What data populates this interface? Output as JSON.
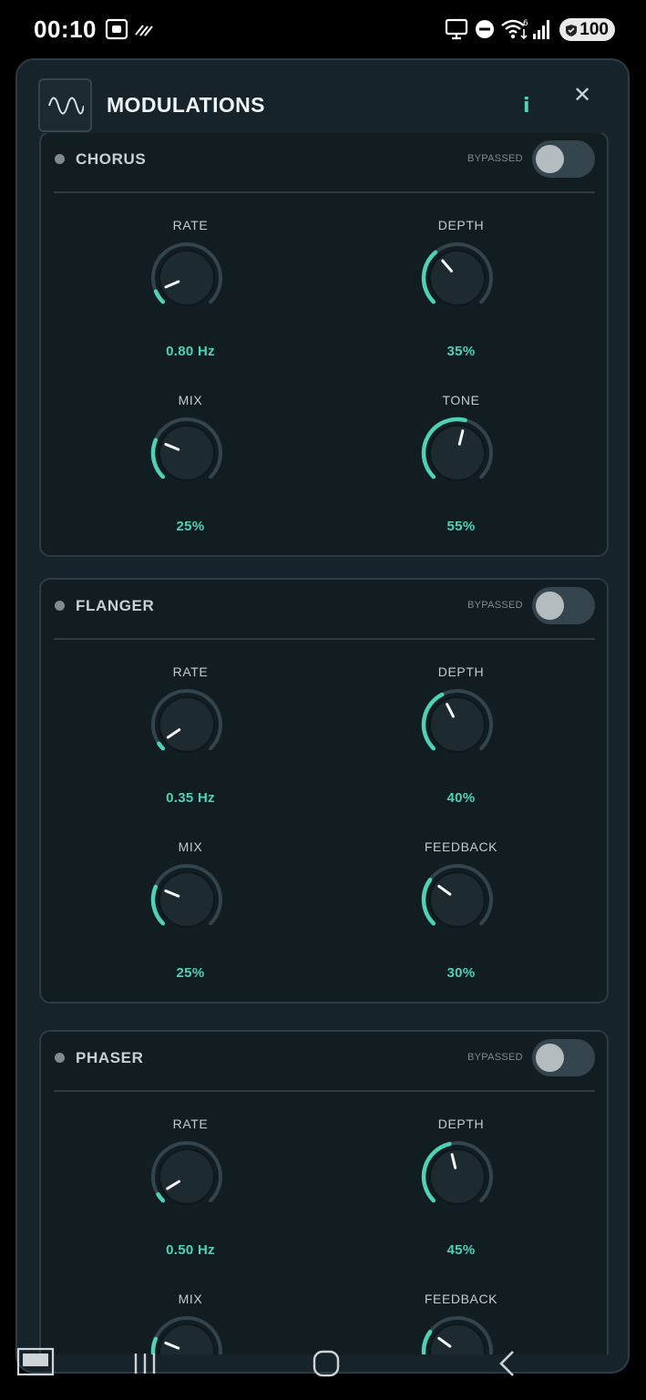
{
  "status_bar": {
    "time": "00:10",
    "battery": "100",
    "icons": [
      "screenshot-icon",
      "nfc-icon",
      "monitor-icon",
      "dnd-icon",
      "wifi-icon",
      "signal-icon",
      "battery-icon"
    ]
  },
  "modal": {
    "title": "MODULATIONS",
    "info_label": "i",
    "close_label": "✕",
    "logo_icon": "wave-icon"
  },
  "colors": {
    "accent": "#4fd1b5",
    "panel": "#16232a",
    "section": "#121d22",
    "track": "#33444c"
  },
  "sections": [
    {
      "name": "CHORUS",
      "status": "BYPASSED",
      "enabled": false,
      "knobs": [
        {
          "label": "RATE",
          "value": "0.80 Hz",
          "level": 0.08
        },
        {
          "label": "DEPTH",
          "value": "35%",
          "level": 0.35
        },
        {
          "label": "MIX",
          "value": "25%",
          "level": 0.25
        },
        {
          "label": "TONE",
          "value": "55%",
          "level": 0.55
        }
      ]
    },
    {
      "name": "FLANGER",
      "status": "BYPASSED",
      "enabled": false,
      "knobs": [
        {
          "label": "RATE",
          "value": "0.35 Hz",
          "level": 0.04
        },
        {
          "label": "DEPTH",
          "value": "40%",
          "level": 0.4
        },
        {
          "label": "MIX",
          "value": "25%",
          "level": 0.25
        },
        {
          "label": "FEEDBACK",
          "value": "30%",
          "level": 0.3
        }
      ]
    },
    {
      "name": "PHASER",
      "status": "BYPASSED",
      "enabled": false,
      "knobs": [
        {
          "label": "RATE",
          "value": "0.50 Hz",
          "level": 0.05
        },
        {
          "label": "DEPTH",
          "value": "45%",
          "level": 0.45
        },
        {
          "label": "MIX",
          "value": "",
          "level": 0.25
        },
        {
          "label": "FEEDBACK",
          "value": "",
          "level": 0.3
        }
      ]
    }
  ],
  "nav_bar": {
    "icons": [
      "keyboard-icon",
      "recents-icon",
      "home-icon",
      "back-icon"
    ]
  }
}
